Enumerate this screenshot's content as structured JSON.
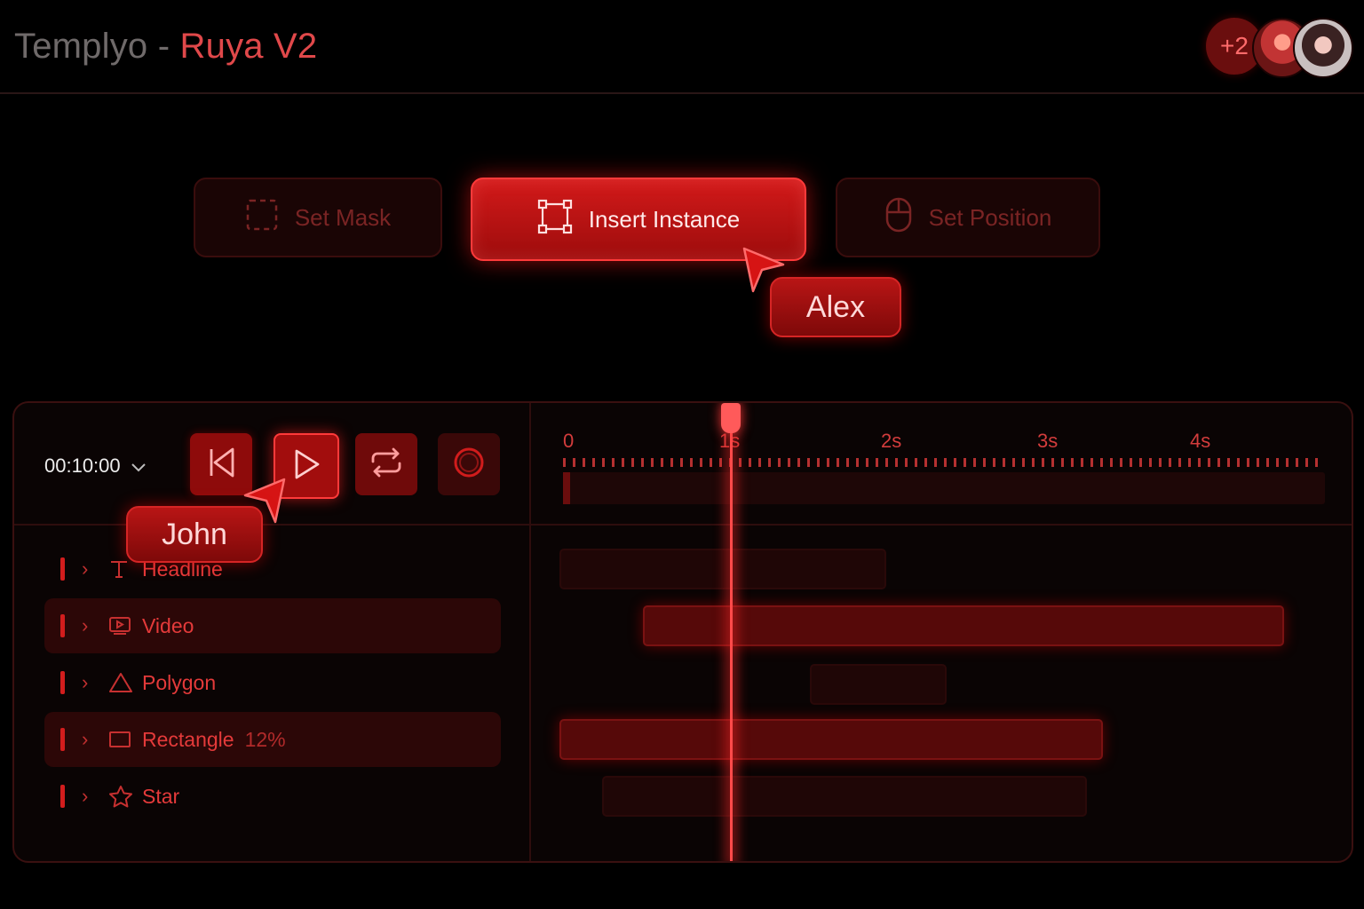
{
  "header": {
    "app_name": "Templyo",
    "separator": "-",
    "project_name": "Ruya V2",
    "collaborators_more": "+2"
  },
  "actions": {
    "set_mask": "Set Mask",
    "insert_instance": "Insert Instance",
    "set_position": "Set Position"
  },
  "cursors": {
    "alex": "Alex",
    "john": "John"
  },
  "timeline": {
    "timecode": "00:10:00",
    "ruler_labels": [
      "0",
      "1s",
      "2s",
      "3s",
      "4s"
    ],
    "layers": [
      {
        "name": "Headline",
        "icon": "text-icon",
        "extra": ""
      },
      {
        "name": "Video",
        "icon": "video-icon",
        "extra": ""
      },
      {
        "name": "Polygon",
        "icon": "triangle-icon",
        "extra": ""
      },
      {
        "name": "Rectangle",
        "icon": "rectangle-icon",
        "extra": "12%"
      },
      {
        "name": "Star",
        "icon": "star-icon",
        "extra": ""
      }
    ]
  },
  "colors": {
    "accent": "#ff3b3b",
    "background": "#000000"
  }
}
